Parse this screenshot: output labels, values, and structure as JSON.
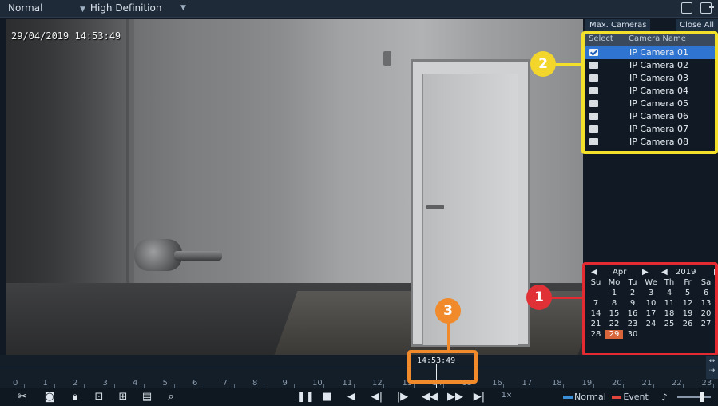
{
  "topbar": {
    "mode_label": "Normal",
    "quality_label": "High Definition"
  },
  "video": {
    "osd_timestamp": "29/04/2019 14:53:49"
  },
  "camera_panel": {
    "max_cameras_label": "Max. Cameras",
    "close_all_label": "Close All",
    "header_select": "Select",
    "header_name": "Camera Name",
    "cameras": [
      {
        "name": "IP Camera 01",
        "checked": true,
        "selected": true
      },
      {
        "name": "IP Camera 02",
        "checked": false,
        "selected": false
      },
      {
        "name": "IP Camera 03",
        "checked": false,
        "selected": false
      },
      {
        "name": "IP Camera 04",
        "checked": false,
        "selected": false
      },
      {
        "name": "IP Camera 05",
        "checked": false,
        "selected": false
      },
      {
        "name": "IP Camera 06",
        "checked": false,
        "selected": false
      },
      {
        "name": "IP Camera 07",
        "checked": false,
        "selected": false
      },
      {
        "name": "IP Camera 08",
        "checked": false,
        "selected": false
      }
    ]
  },
  "calendar": {
    "month": "Apr",
    "year": "2019",
    "weekdays": [
      "Su",
      "Mo",
      "Tu",
      "We",
      "Th",
      "Fr",
      "Sa"
    ],
    "weeks": [
      [
        "",
        "1",
        "2",
        "3",
        "4",
        "5",
        "6"
      ],
      [
        "7",
        "8",
        "9",
        "10",
        "11",
        "12",
        "13"
      ],
      [
        "14",
        "15",
        "16",
        "17",
        "18",
        "19",
        "20"
      ],
      [
        "21",
        "22",
        "23",
        "24",
        "25",
        "26",
        "27"
      ],
      [
        "28",
        "29",
        "30",
        "",
        "",
        "",
        ""
      ]
    ],
    "selected_day": "29"
  },
  "callouts": {
    "one": "1",
    "two": "2",
    "three": "3"
  },
  "timeline": {
    "current_time": "14:53:49",
    "hours": [
      "0",
      "1",
      "2",
      "3",
      "4",
      "5",
      "6",
      "7",
      "8",
      "9",
      "10",
      "11",
      "12",
      "13",
      "14",
      "15",
      "16",
      "17",
      "18",
      "19",
      "20",
      "21",
      "22",
      "23"
    ]
  },
  "toolbar": {
    "speed": "1×",
    "legend_normal": "Normal",
    "legend_event": "Event",
    "normal_color": "#3a8fd6",
    "event_color": "#e0463b"
  }
}
